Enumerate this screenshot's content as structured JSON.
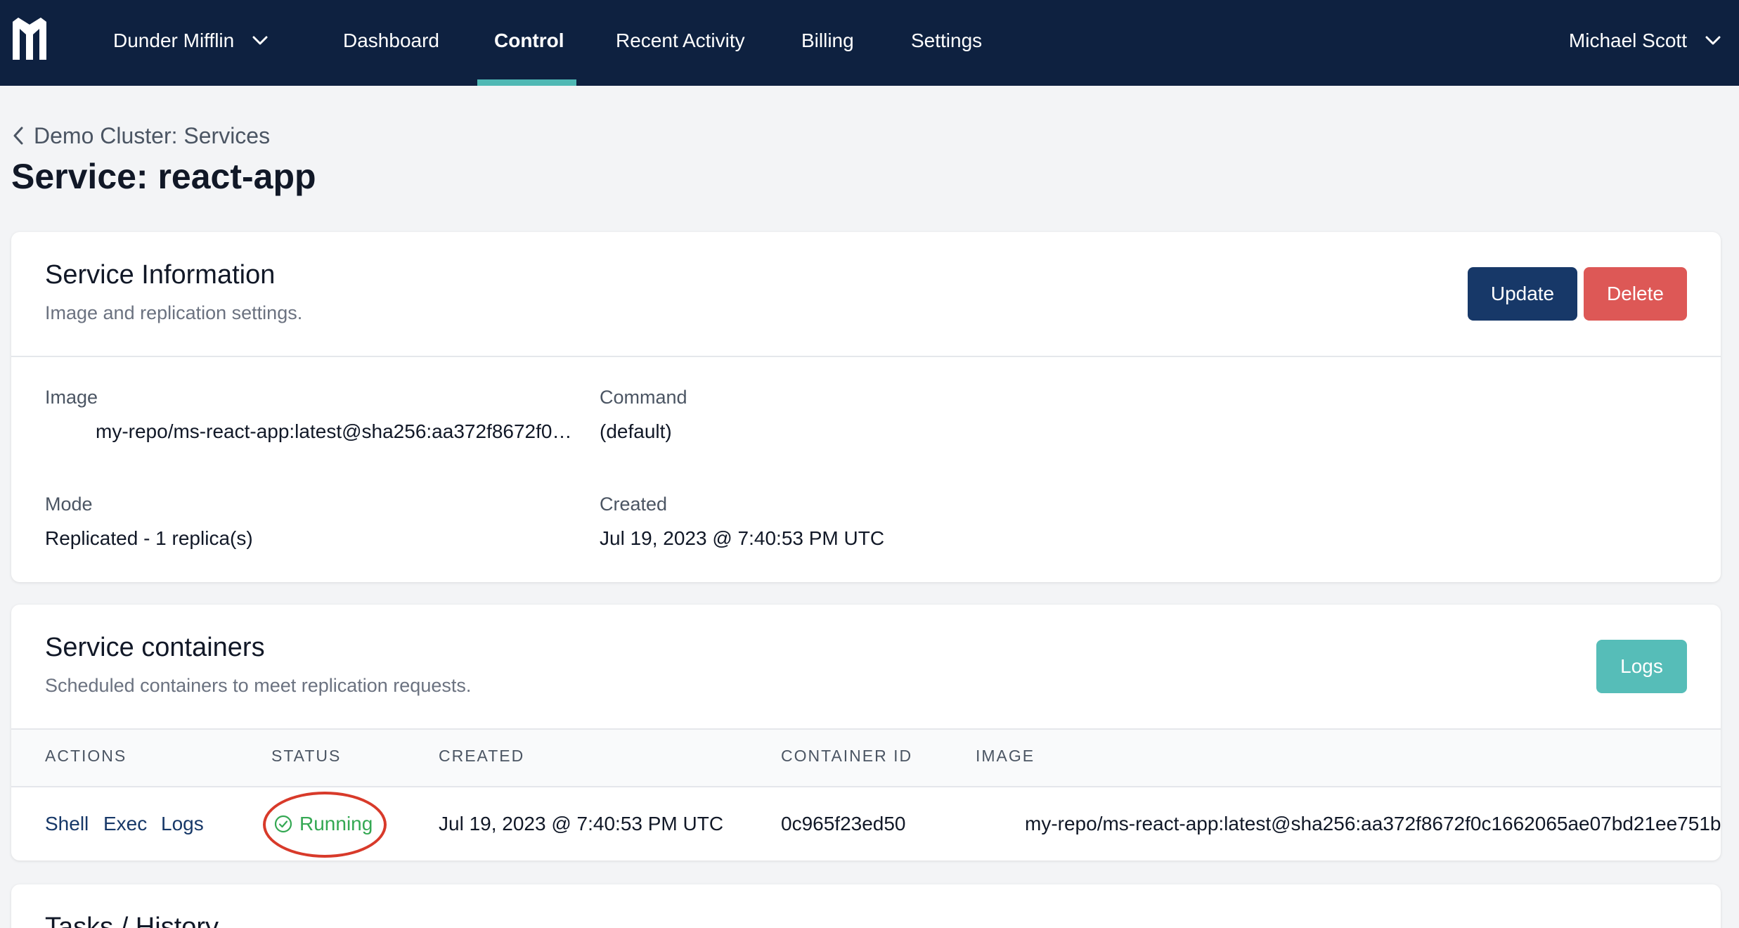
{
  "nav": {
    "org_name": "Dunder Mifflin",
    "items": [
      {
        "label": "Dashboard"
      },
      {
        "label": "Control"
      },
      {
        "label": "Recent Activity"
      },
      {
        "label": "Billing"
      },
      {
        "label": "Settings"
      }
    ],
    "active": "Control",
    "user_name": "Michael Scott"
  },
  "breadcrumb": {
    "back_label": "Demo Cluster: Services"
  },
  "page": {
    "title": "Service: react-app"
  },
  "service_info": {
    "title": "Service Information",
    "subtitle": "Image and replication settings.",
    "update_label": "Update",
    "delete_label": "Delete",
    "fields": {
      "image_label": "Image",
      "image_value": "my-repo/ms-react-app:latest@sha256:aa372f8672f0…",
      "command_label": "Command",
      "command_value": "(default)",
      "mode_label": "Mode",
      "mode_value": "Replicated - 1 replica(s)",
      "created_label": "Created",
      "created_value": "Jul 19, 2023 @ 7:40:53 PM UTC"
    }
  },
  "containers": {
    "title": "Service containers",
    "subtitle": "Scheduled containers to meet replication requests.",
    "logs_label": "Logs",
    "columns": [
      "ACTIONS",
      "STATUS",
      "CREATED",
      "CONTAINER ID",
      "IMAGE"
    ],
    "rows": [
      {
        "actions": [
          "Shell",
          "Exec",
          "Logs"
        ],
        "status": "Running",
        "created": "Jul 19, 2023 @ 7:40:53 PM UTC",
        "container_id": "0c965f23ed50",
        "image": "my-repo/ms-react-app:latest@sha256:aa372f8672f0c1662065ae07bd21ee751b"
      }
    ]
  },
  "tasks": {
    "title": "Tasks / History"
  },
  "colors": {
    "nav_bg": "#0e2140",
    "accent": "#4fb8b4",
    "update": "#173868",
    "delete": "#dd5856",
    "logs": "#56bdb8",
    "running": "#34a853",
    "highlight_ring": "#d83a2a"
  },
  "icons": [
    "logo-icon",
    "chevron-down-icon",
    "chevron-left-icon",
    "check-circle-icon"
  ]
}
